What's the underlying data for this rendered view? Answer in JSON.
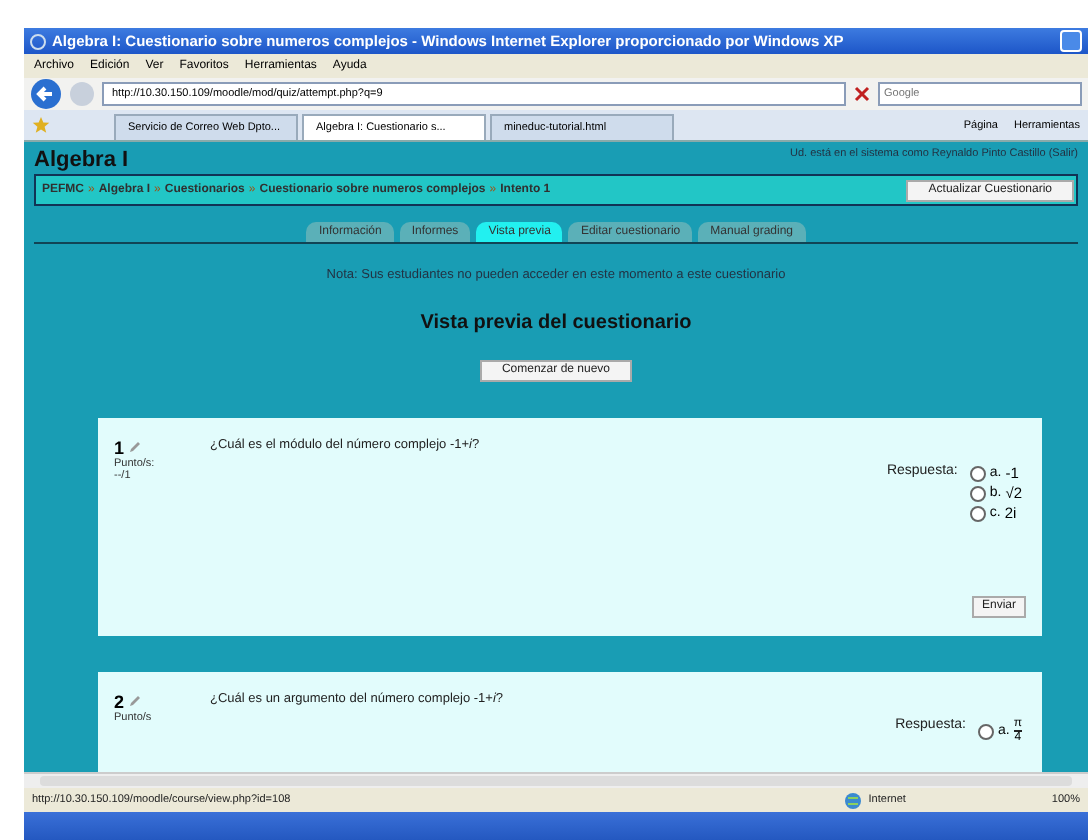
{
  "window": {
    "title": "Algebra I: Cuestionario sobre numeros complejos - Windows Internet Explorer proporcionado por Windows XP"
  },
  "menu": [
    "Archivo",
    "Edición",
    "Ver",
    "Favoritos",
    "Herramientas",
    "Ayuda"
  ],
  "address": "http://10.30.150.109/moodle/mod/quiz/attempt.php?q=9",
  "search": {
    "placeholder": "Google"
  },
  "browser_tabs": [
    {
      "label": "Servicio de Correo Web Dpto...",
      "selected": false
    },
    {
      "label": "Algebra I: Cuestionario s...",
      "selected": true
    },
    {
      "label": "mineduc-tutorial.html",
      "selected": false
    }
  ],
  "toolbar": [
    "Página",
    "Herramientas"
  ],
  "page": {
    "course_title": "Algebra I",
    "login_text": "Ud. está en el sistema como Reynaldo Pinto Castillo  (Salir)",
    "breadcrumb_separator": "»",
    "breadcrumb": [
      "PEFMC",
      "Algebra I",
      "Cuestionarios",
      "Cuestionario sobre numeros complejos",
      "Intento 1"
    ],
    "update_button": "Actualizar Cuestionario",
    "tabs": [
      {
        "label": "Información",
        "selected": false
      },
      {
        "label": "Informes",
        "selected": false
      },
      {
        "label": "Vista previa",
        "selected": true
      },
      {
        "label": "Editar cuestionario",
        "selected": false
      },
      {
        "label": "Manual grading",
        "selected": false
      }
    ],
    "note": "Nota: Sus estudiantes no pueden acceder en este momento a este cuestionario",
    "heading": "Vista previa del cuestionario",
    "restart_button": "Comenzar de nuevo",
    "questions": [
      {
        "number": "1",
        "text": "¿Cuál es el módulo del número complejo -1+*i*?",
        "points_label": "Punto/s:",
        "points": "--/1",
        "answer_label": "Respuesta:",
        "options": [
          {
            "letter": "a.",
            "kind": "text",
            "value": "-1",
            "selected": false
          },
          {
            "letter": "b.",
            "kind": "text",
            "value": "√2",
            "selected": false
          },
          {
            "letter": "c.",
            "kind": "text",
            "value": "2i",
            "selected": false
          }
        ],
        "submit": "Enviar"
      },
      {
        "number": "2",
        "text": "¿Cuál es un argumento del número complejo -1+*i*?",
        "points_label": "Punto/s",
        "answer_label": "Respuesta:",
        "options": [
          {
            "letter": "a.",
            "kind": "fraction",
            "numerator": "π",
            "denominator": "4",
            "selected": false
          }
        ]
      }
    ]
  },
  "status_bar": {
    "url": "http://10.30.150.109/moodle/course/view.php?id=108",
    "zone": "Internet",
    "zoom": "100%"
  }
}
